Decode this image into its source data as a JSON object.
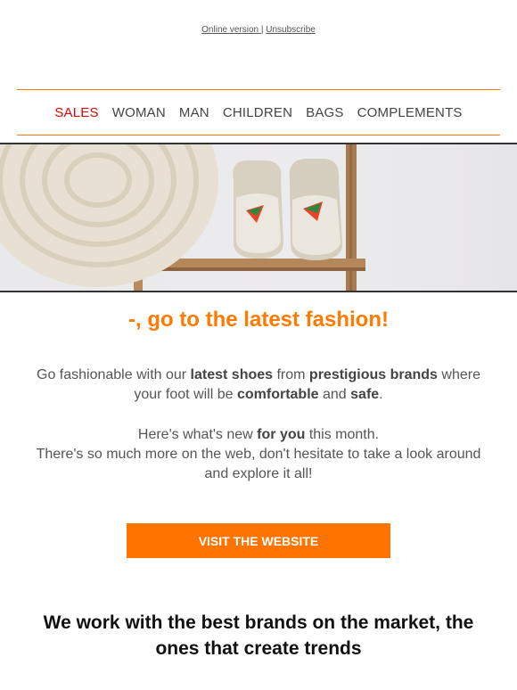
{
  "header": {
    "online_version": "Online version ",
    "separator": "|",
    "unsubscribe": "Unsubscribe"
  },
  "nav": {
    "items": [
      "SALES",
      "WOMAN",
      "MAN",
      "CHILDREN",
      "BAGS",
      "COMPLEMENTS"
    ],
    "active_color": "#e60000",
    "border_color": "#ff7a00"
  },
  "hero": {
    "image": "espadrilles-on-wooden-shelf-with-straw-hat",
    "accent": "#ff7300"
  },
  "headline": "-, go to the latest fashion!",
  "paragraph1": {
    "t1": "Go fashionable with our ",
    "b1": "latest shoes",
    "t2": " from ",
    "b2": "prestigious brands",
    "t3": " where your foot will be ",
    "b3": "comfortable",
    "t4": " and ",
    "b4": "safe",
    "t5": "."
  },
  "paragraph2": {
    "t1": "Here's what's new ",
    "b1": "for you",
    "t2": " this month.",
    "line2": "There's so much more on the web, don't hesitate to take a look around and explore it all!"
  },
  "cta": {
    "label": "VISIT THE WEBSITE",
    "color": "#ff7300"
  },
  "brands_heading": "We work with the best brands on the market, the ones that create trends"
}
